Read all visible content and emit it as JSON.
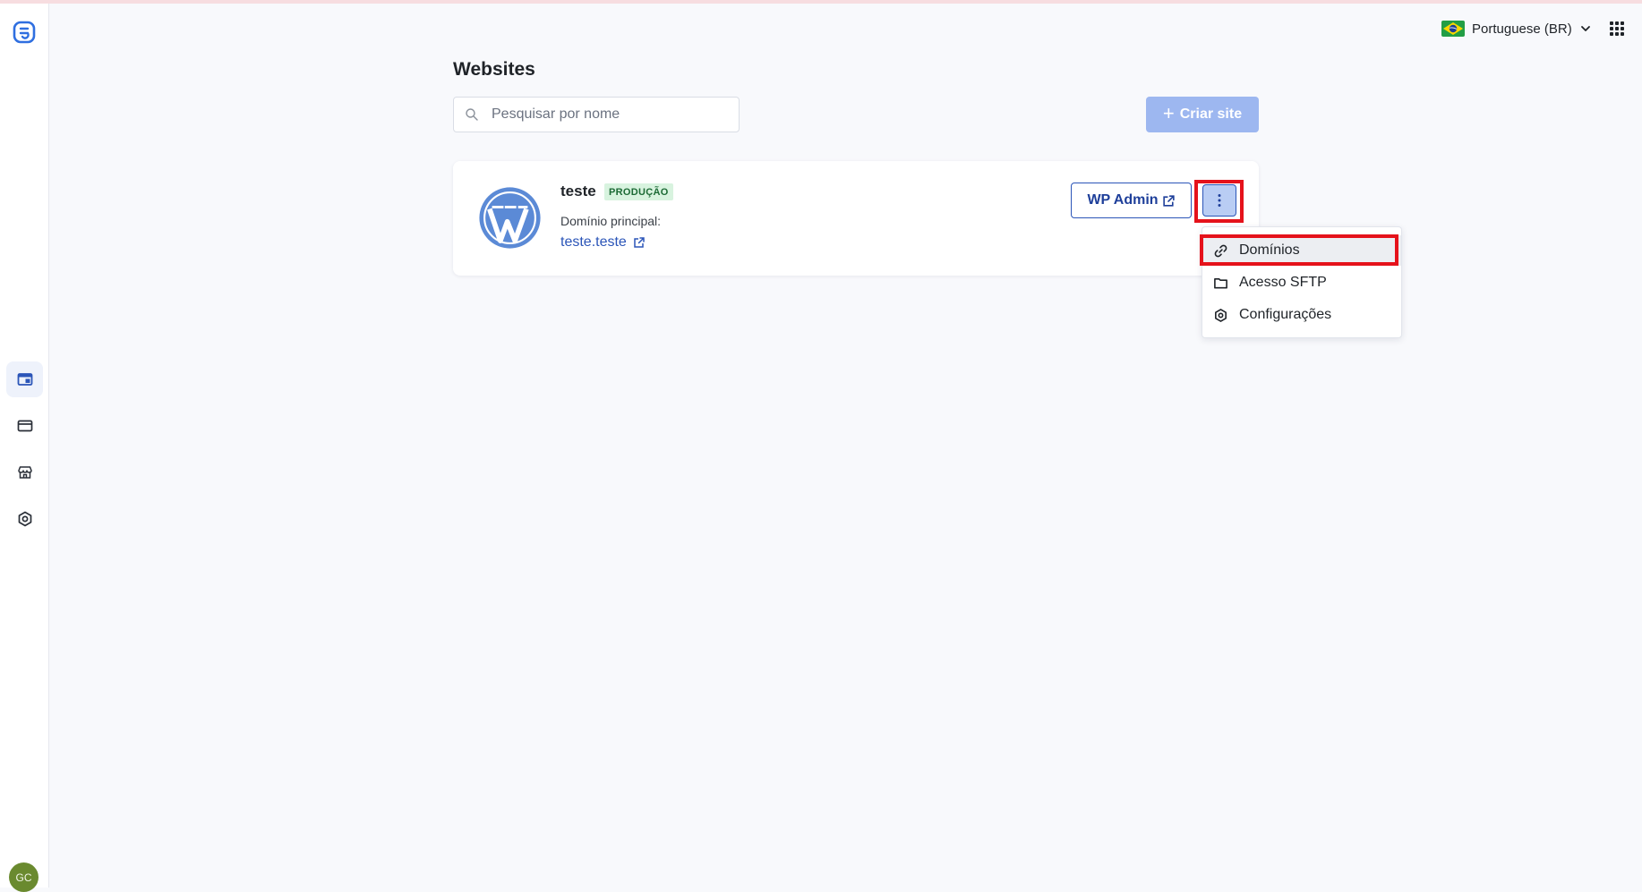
{
  "header": {
    "language_label": "Portuguese (BR)"
  },
  "main": {
    "title": "Websites",
    "search_placeholder": "Pesquisar por nome",
    "create_button_label": "Criar site"
  },
  "site_card": {
    "name": "teste",
    "environment_badge": "PRODUÇÃO",
    "domain_label": "Domínio principal:",
    "domain_value": "teste.teste",
    "wp_admin_label": "WP Admin"
  },
  "dropdown_menu": {
    "items": [
      {
        "label": "Domínios",
        "icon": "link-icon"
      },
      {
        "label": "Acesso SFTP",
        "icon": "folder-icon"
      },
      {
        "label": "Configurações",
        "icon": "gear-icon"
      }
    ]
  },
  "user": {
    "initials": "GC"
  },
  "colors": {
    "brand_blue": "#2b55b8",
    "highlight_red": "#e5121b",
    "badge_green_bg": "#d8f3df",
    "wordpress_blue": "#5b8ad6"
  }
}
